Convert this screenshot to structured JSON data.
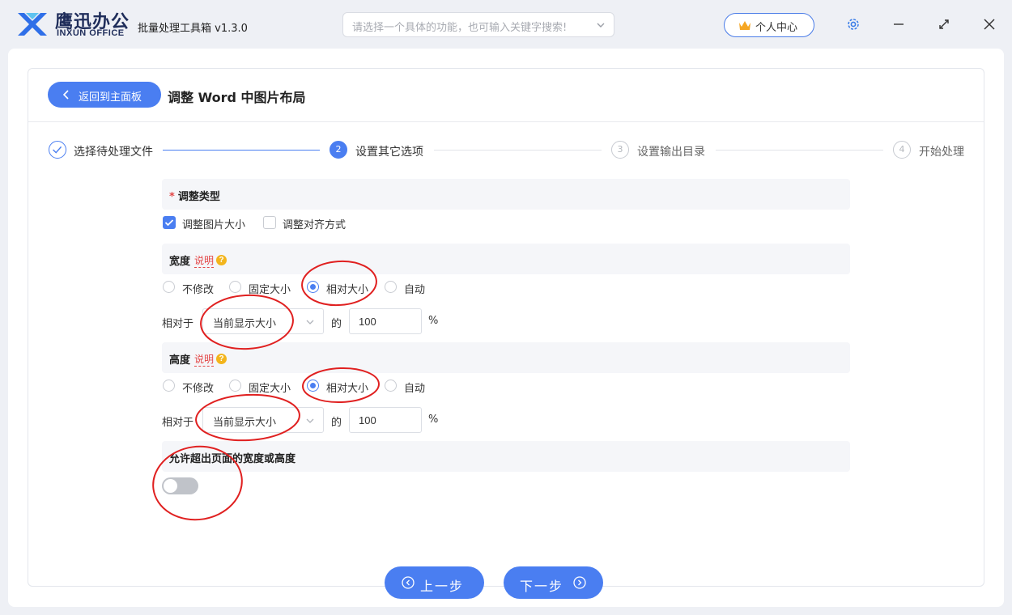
{
  "brand": {
    "name_cn": "鹰迅办公",
    "name_en": "INXUN OFFICE",
    "app_title": "批量处理工具箱 v1.3.0"
  },
  "search": {
    "placeholder": "请选择一个具体的功能，也可输入关键字搜索!"
  },
  "header": {
    "user_center": "个人中心",
    "icons": [
      "gear-icon",
      "minimize-icon",
      "maximize-icon",
      "close-icon"
    ]
  },
  "page": {
    "back_label": "返回到主面板",
    "title": "调整 Word 中图片布局"
  },
  "steps": [
    {
      "num": "1",
      "label": "选择待处理文件",
      "state": "done"
    },
    {
      "num": "2",
      "label": "设置其它选项",
      "state": "active"
    },
    {
      "num": "3",
      "label": "设置输出目录",
      "state": "todo"
    },
    {
      "num": "4",
      "label": "开始处理",
      "state": "todo"
    }
  ],
  "adjust_type": {
    "required_mark": "*",
    "title": "调整类型",
    "options": [
      {
        "label": "调整图片大小",
        "checked": true
      },
      {
        "label": "调整对齐方式",
        "checked": false
      }
    ]
  },
  "width": {
    "title": "宽度",
    "help": "说明",
    "help_icon": "?",
    "options": [
      "不修改",
      "固定大小",
      "相对大小",
      "自动"
    ],
    "selected": "相对大小",
    "relative_label": "相对于",
    "relative_select": "当前显示大小",
    "of_label": "的",
    "value": "100",
    "unit": "%"
  },
  "height": {
    "title": "高度",
    "help": "说明",
    "help_icon": "?",
    "options": [
      "不修改",
      "固定大小",
      "相对大小",
      "自动"
    ],
    "selected": "相对大小",
    "relative_label": "相对于",
    "relative_select": "当前显示大小",
    "of_label": "的",
    "value": "100",
    "unit": "%"
  },
  "overflow": {
    "title": "允许超出页面的宽度或高度",
    "enabled": false
  },
  "footer": {
    "prev_label": "上一步",
    "next_label": "下一步"
  },
  "colors": {
    "accent": "#4a7ef1",
    "annotation": "#e02020",
    "required": "#e34646"
  }
}
